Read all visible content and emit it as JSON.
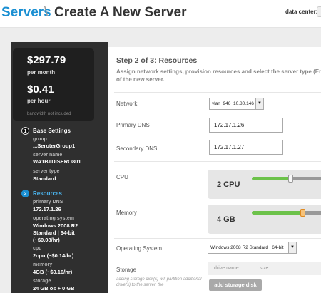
{
  "header": {
    "breadcrumb_link": "Servers",
    "separator": "\\",
    "title": "Create A New Server",
    "data_center_label": "data center:"
  },
  "cost": {
    "monthly_price": "$297.79",
    "monthly_label": "per month",
    "hourly_price": "$0.41",
    "hourly_label": "per hour",
    "bandwidth_note": "bandwidth not included"
  },
  "steps": [
    {
      "number": "1",
      "title": "Base Settings",
      "fields": [
        {
          "label": "group",
          "value": "...SeroterGroup1"
        },
        {
          "label": "server name",
          "value": "WA1BTDISERO801"
        },
        {
          "label": "server type",
          "value": "Standard"
        }
      ]
    },
    {
      "number": "2",
      "title": "Resources",
      "fields": [
        {
          "label": "primary DNS",
          "value": "172.17.1.26"
        },
        {
          "label": "operating system",
          "value": "Windows 2008 R2 Standard | 64-bit (~$0.08/hr)"
        },
        {
          "label": "cpu",
          "value": "2cpu (~$0.14/hr)"
        },
        {
          "label": "memory",
          "value": "4GB (~$0.16/hr)"
        },
        {
          "label": "storage",
          "value": "24 GB os + 0 GB"
        }
      ]
    }
  ],
  "form": {
    "heading": "Step 2 of 3: Resources",
    "description": "Assign network settings, provision resources and select the server type (Ent of the new server.",
    "network": {
      "label": "Network",
      "value": "vlan_946_10.80.146"
    },
    "primary_dns": {
      "label": "Primary DNS",
      "value": "172.17.1.26"
    },
    "secondary_dns": {
      "label": "Secondary DNS",
      "value": "172.17.1.27"
    },
    "cpu": {
      "label": "CPU",
      "value": "2 CPU",
      "level": 0.4
    },
    "memory": {
      "label": "Memory",
      "value": "4 GB",
      "level": 0.55
    },
    "os": {
      "label": "Operating System",
      "value": "Windows 2008 R2 Standard | 64-bit"
    },
    "storage": {
      "label": "Storage",
      "columns": [
        "drive name",
        "size"
      ],
      "help": "adding storage disk(s) will partition additional drive(s) to the server. the",
      "add_button": "add storage disk"
    }
  },
  "icons": {
    "dropdown": "chevron-down-icon"
  },
  "colors": {
    "accent": "#1a8fd2",
    "sidebar": "#2f2f2f",
    "slider_fill": "#6cc24a"
  }
}
